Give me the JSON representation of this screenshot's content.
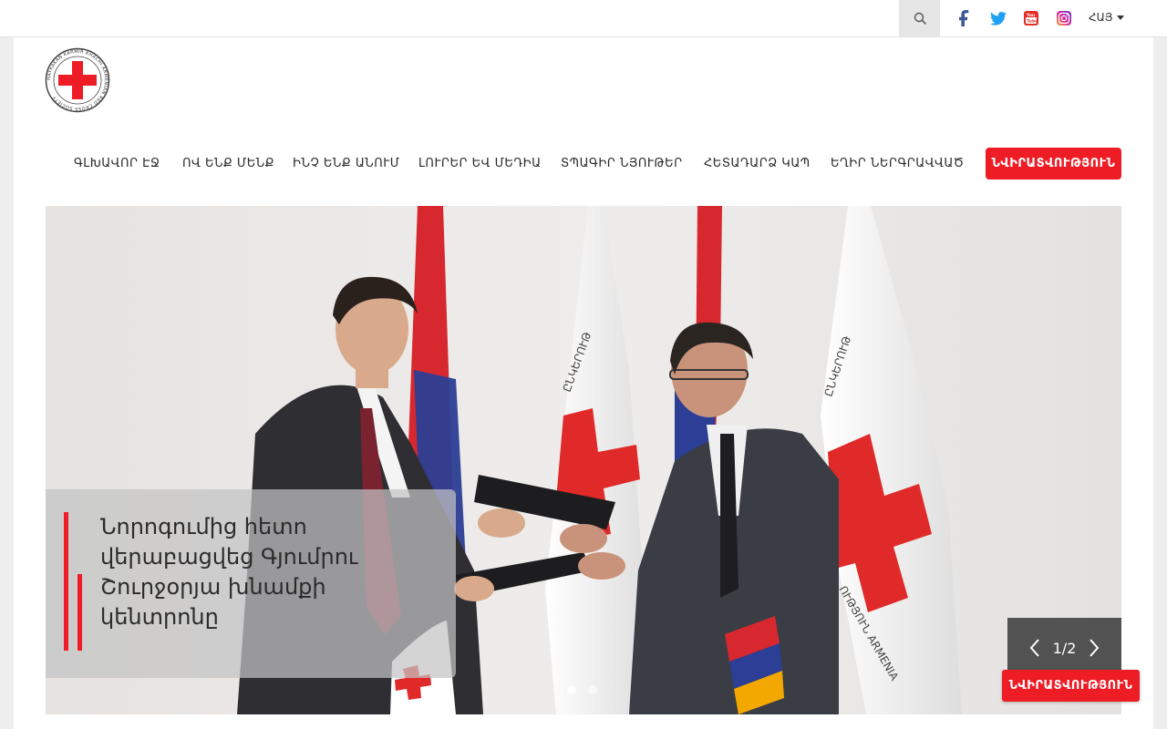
{
  "topbar": {
    "language": "ՀԱՅ",
    "icons": [
      "search-icon",
      "facebook-icon",
      "twitter-icon",
      "youtube-icon",
      "instagram-icon",
      "chevron-down-icon"
    ],
    "colors": {
      "facebook": "#3b5998",
      "twitter": "#1da1f2",
      "youtube": "#e52d27",
      "instagram": "#c13584"
    }
  },
  "header": {
    "logo_alt_text": "HAYKAKAN KARMIR KHACHI ARMENIAN RED CROSS SOCIETY"
  },
  "nav": {
    "items": [
      {
        "label": "ԳԼԽԱՎՈՐ ԷՋ"
      },
      {
        "label": "ՈՎ ԵՆՔ ՄԵՆՔ"
      },
      {
        "label": "ԻՆՉ ԵՆՔ ԱՆՈՒՄ"
      },
      {
        "label": "ԼՈՒՐԵՐ ԵՎ ՄԵԴԻԱ"
      },
      {
        "label": "ՏՊԱԳԻՐ ՆՅՈՒԹԵՐ"
      },
      {
        "label": "ՀԵՏԱԴԱՐՁ ԿԱՊ"
      },
      {
        "label": "ԵՂԻՐ ՆԵՐԳՐԱՎՎԱԾ"
      }
    ],
    "donate_label": "ՆՎԻՐԱՏՎՈՒԹՅՈՒՆ"
  },
  "slider": {
    "caption": "Նորոգումից հետո վերաբացվեց Գյումրու Շուրջօրյա խնամքի կենտրոնը",
    "counter": "1/2",
    "current_slide": 1,
    "total_slides": 2,
    "flag_text_1": "ԸՆԿԵՐՈՒԹ",
    "flag_text_2": "ԸՆԿԵՐՈՒԹ",
    "flag_text_3": "ՈՒԹՅՈՒՆ ARMENIA"
  },
  "floating": {
    "donate_label": "ՆՎԻՐԱՏՎՈՒԹՅՈՒՆ"
  },
  "colors": {
    "accent": "#ee1c25",
    "topbar_bg": "#ffffff",
    "page_bg": "#eeeeee"
  }
}
